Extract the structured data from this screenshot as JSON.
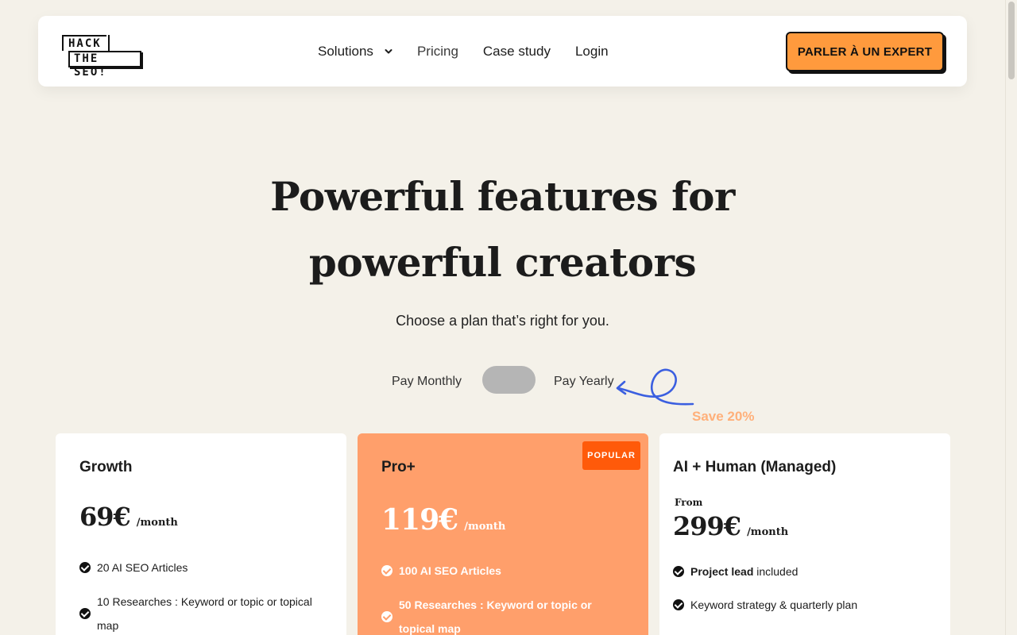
{
  "header": {
    "logo": {
      "line1": "HACK",
      "line2": "THE SEO!"
    },
    "nav": [
      {
        "label": "Solutions",
        "has_dropdown": true
      },
      {
        "label": "Pricing"
      },
      {
        "label": "Case study"
      },
      {
        "label": "Login"
      }
    ],
    "cta_label": "PARLER À UN EXPERT"
  },
  "hero": {
    "title_line1": "Powerful features for",
    "title_line2": "powerful creators",
    "subtitle": "Choose a plan that’s right for you."
  },
  "billing": {
    "monthly_label": "Pay Monthly",
    "yearly_label": "Pay Yearly",
    "save_label": "Save 20%"
  },
  "plans": [
    {
      "name": "Growth",
      "price": "69€",
      "unit": "/month",
      "features": [
        {
          "text": "20 AI SEO Articles"
        },
        {
          "text": "10 Researches : Keyword or topic or topical map"
        }
      ]
    },
    {
      "name": "Pro+",
      "badge": "POPULAR",
      "price": "119€",
      "unit": "/month",
      "features": [
        {
          "text": "100 AI SEO Articles"
        },
        {
          "text": "50 Researches : Keyword or topic or topical map"
        }
      ]
    },
    {
      "name": "AI + Human (Managed)",
      "from_label": "From",
      "price": "299€",
      "unit": "/month",
      "features": [
        {
          "strong": "Project lead",
          "text": " included"
        },
        {
          "text": "Keyword strategy & quarterly plan"
        }
      ]
    }
  ],
  "colors": {
    "background": "#f4f1e9",
    "accent": "#ff9a3d",
    "pro_card": "#ff9f6b",
    "badge": "#ff5a0a",
    "save": "#ffb07a",
    "arrow": "#3b5fe0"
  }
}
